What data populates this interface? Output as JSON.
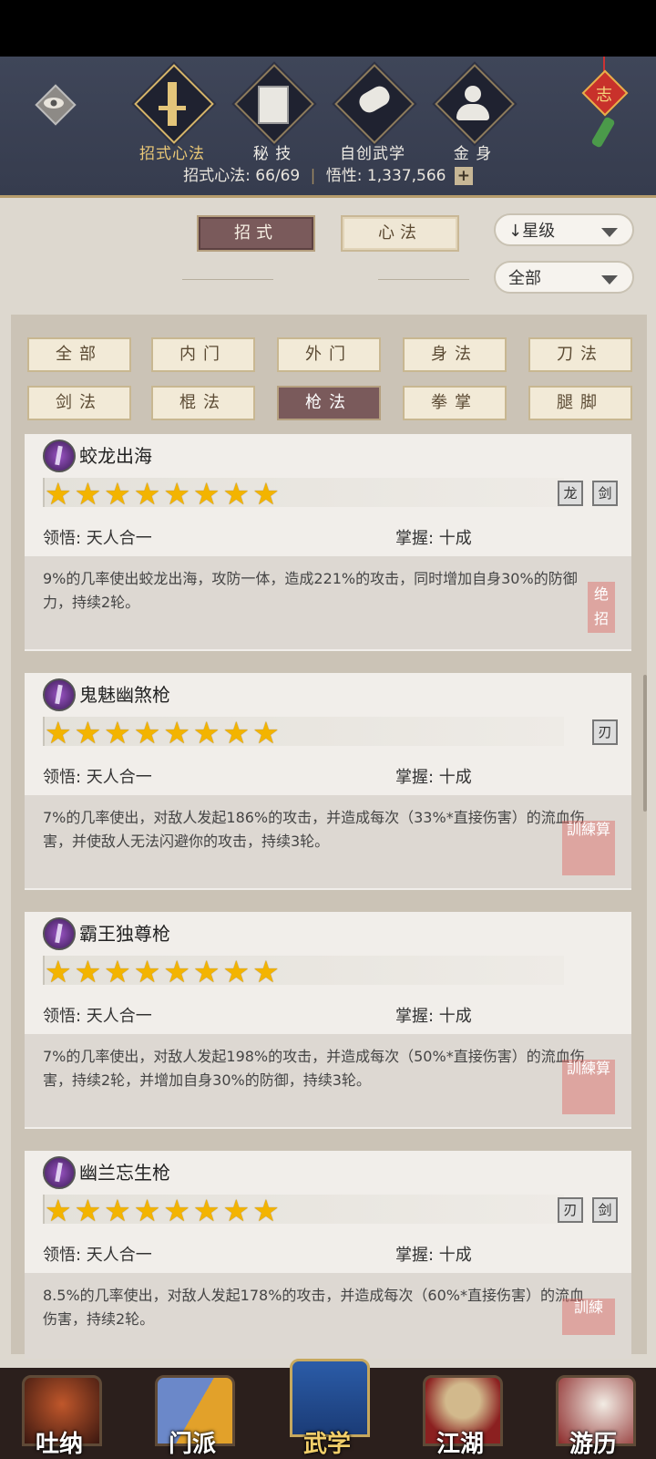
{
  "header": {
    "tabs": [
      {
        "label": "招式心法",
        "icon": "sword-icon",
        "active": true
      },
      {
        "label": "秘 技",
        "icon": "book-icon",
        "active": false
      },
      {
        "label": "自创武学",
        "icon": "scroll-icon",
        "active": false
      },
      {
        "label": "金 身",
        "icon": "meditation-icon",
        "active": false
      }
    ],
    "counter_label": "招式心法: 66/69",
    "wisdom_label": "悟性: 1,337,566",
    "add_symbol": "+",
    "charm_char": "志"
  },
  "toggle": {
    "left": "招式",
    "right": "心法"
  },
  "sort": {
    "value": "↓星级",
    "filter_value": "全部"
  },
  "filters": [
    {
      "label": "全部",
      "active": false
    },
    {
      "label": "内门",
      "active": false
    },
    {
      "label": "外门",
      "active": false
    },
    {
      "label": "身法",
      "active": false
    },
    {
      "label": "刀法",
      "active": false
    },
    {
      "label": "剑法",
      "active": false
    },
    {
      "label": "棍法",
      "active": false
    },
    {
      "label": "枪法",
      "active": true
    },
    {
      "label": "拳掌",
      "active": false
    },
    {
      "label": "腿脚",
      "active": false
    }
  ],
  "skills": [
    {
      "name": "蛟龙出海",
      "stars": "★★★★★★★★",
      "insight": "领悟: 天人合一",
      "mastery": "掌握: 十成",
      "desc": "9%的几率使出蛟龙出海，攻防一体，造成221%的攻击，同时增加自身30%的防御力，持续2轮。",
      "seal": "绝招",
      "tags": [
        "龙",
        "剑"
      ]
    },
    {
      "name": "鬼魅幽煞枪",
      "stars": "★★★★★★★★",
      "insight": "领悟: 天人合一",
      "mastery": "掌握: 十成",
      "desc": "7%的几率使出，对敌人发起186%的攻击，并造成每次（33%*直接伤害）的流血伤害，并使敌人无法闪避你的攻击，持续3轮。",
      "seal": "訓練算",
      "tags": [
        "刃"
      ]
    },
    {
      "name": "霸王独尊枪",
      "stars": "★★★★★★★★",
      "insight": "领悟: 天人合一",
      "mastery": "掌握: 十成",
      "desc": "7%的几率使出，对敌人发起198%的攻击，并造成每次（50%*直接伤害）的流血伤害，持续2轮，并增加自身30%的防御，持续3轮。",
      "seal": "訓練算",
      "tags": []
    },
    {
      "name": "幽兰忘生枪",
      "stars": "★★★★★★★★",
      "insight": "领悟: 天人合一",
      "mastery": "掌握: 十成",
      "desc": "8.5%的几率使出，对敌人发起178%的攻击，并造成每次（60%*直接伤害）的流血伤害，持续2轮。",
      "seal": "訓練",
      "tags": [
        "刃",
        "剑"
      ]
    }
  ],
  "nav": [
    {
      "label": "吐纳"
    },
    {
      "label": "门派"
    },
    {
      "label": "武学",
      "active": true
    },
    {
      "label": "江湖"
    },
    {
      "label": "游历"
    }
  ],
  "colors": {
    "accent": "#e9c777",
    "active_pill": "#7a5a5b",
    "star": "#f3b400"
  }
}
